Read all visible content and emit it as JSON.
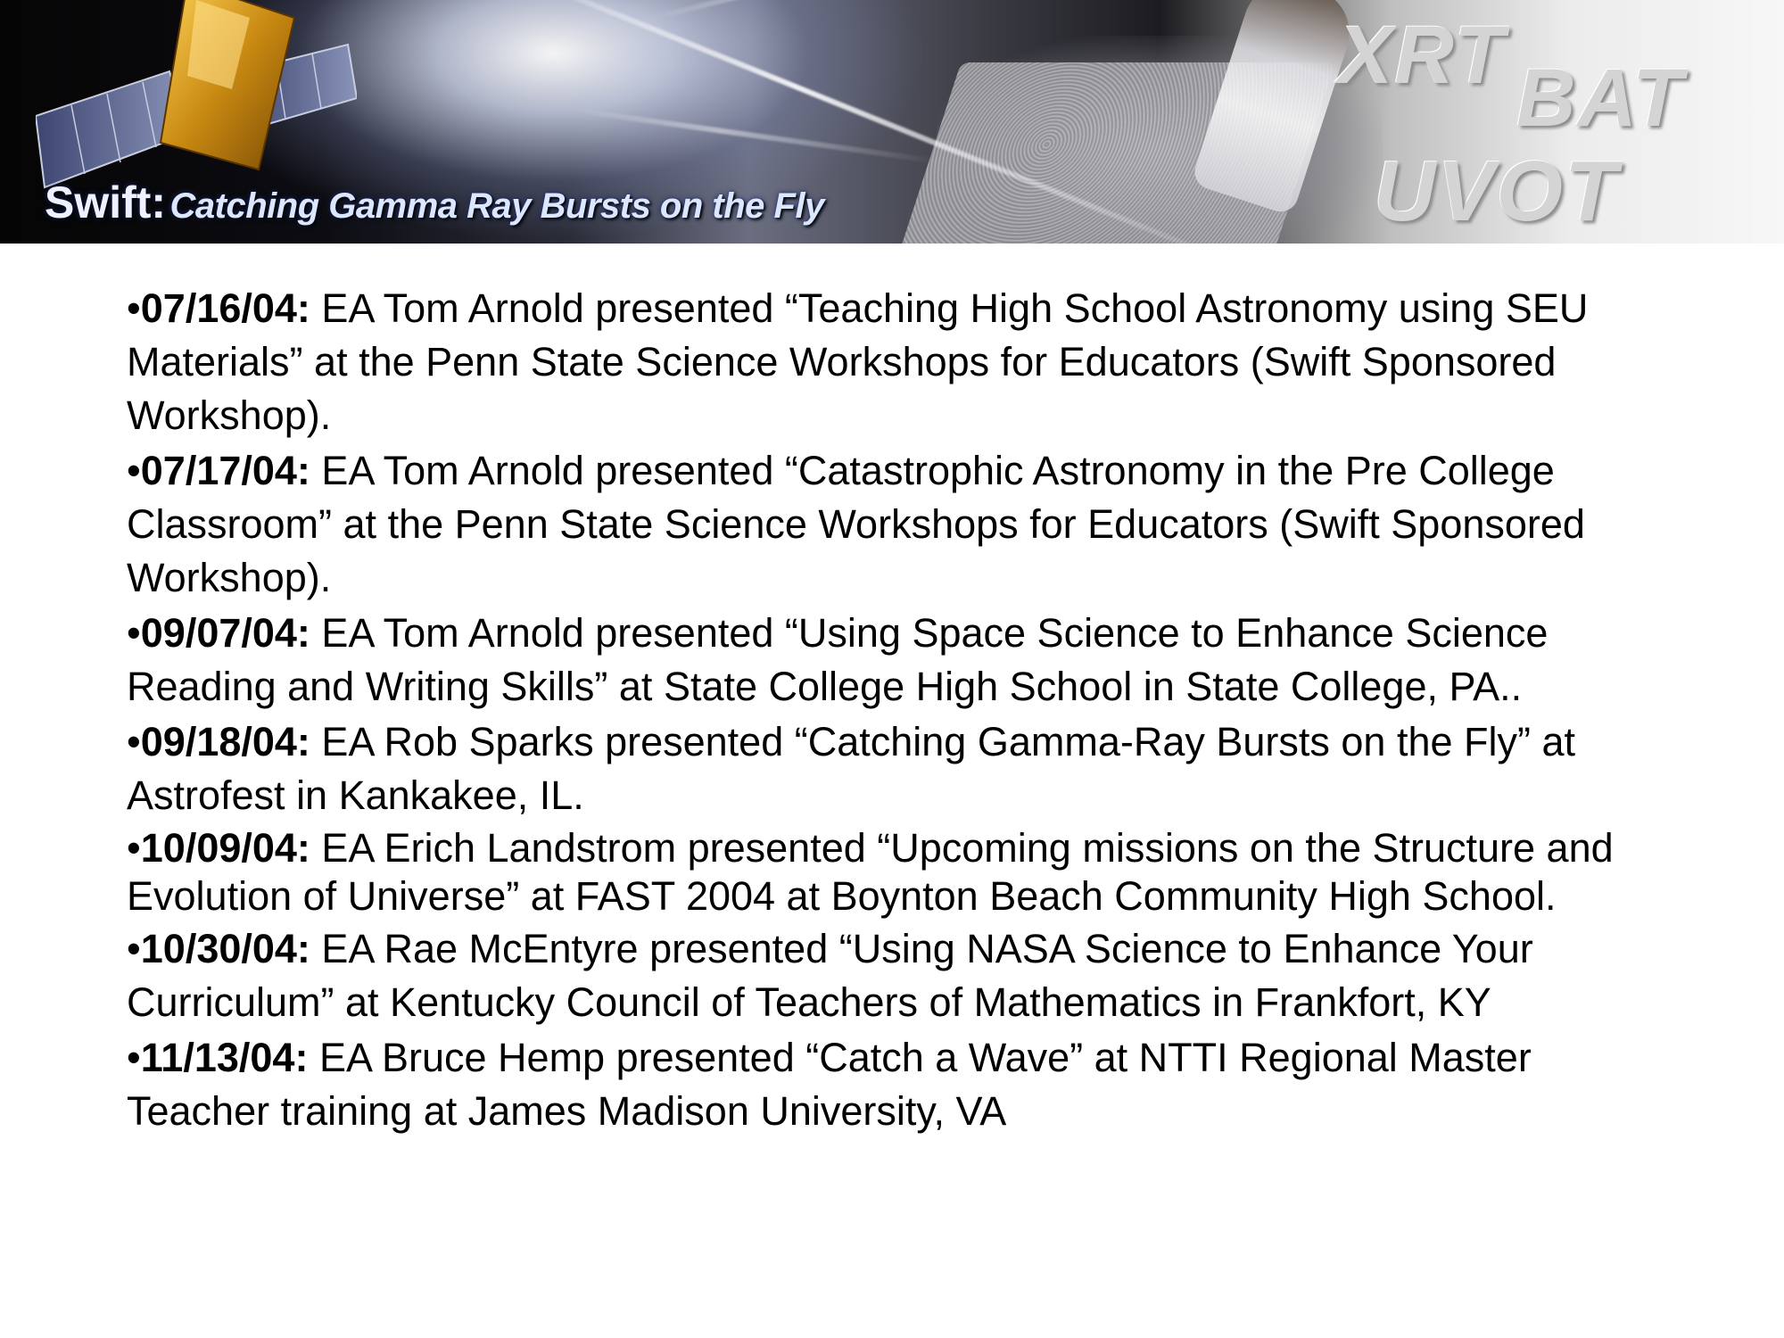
{
  "banner": {
    "title_prefix": "Swift:",
    "title_tagline": "Catching Gamma Ray Bursts on the Fly",
    "instrument_labels": [
      "XRT",
      "BAT",
      "UVOT"
    ]
  },
  "bullet": "•",
  "events": [
    {
      "date": "07/16/04:",
      "text": " EA Tom Arnold presented “Teaching High School Astronomy using SEU Materials” at the Penn State Science Workshops for Educators (Swift Sponsored Workshop)."
    },
    {
      "date": "07/17/04:",
      "text": " EA Tom Arnold presented “Catastrophic Astronomy in the Pre College Classroom” at the Penn State Science Workshops for Educators (Swift Sponsored Workshop)."
    },
    {
      "date": "09/07/04:",
      "text": " EA Tom Arnold presented “Using Space Science to Enhance Science Reading and Writing Skills” at State College High School in State College, PA.."
    },
    {
      "date": "09/18/04:",
      "text": " EA Rob Sparks presented “Catching Gamma-Ray Bursts on the Fly” at Astrofest in Kankakee, IL."
    },
    {
      "date": "10/09/04:",
      "text": " EA Erich Landstrom presented “Upcoming missions on the Structure and Evolution of Universe” at FAST 2004 at Boynton Beach Community High School."
    },
    {
      "date": "10/30/04:",
      "text": " EA Rae McEntyre presented “Using NASA Science to Enhance Your Curriculum” at  Kentucky Council of Teachers of Mathematics in Frankfort, KY"
    },
    {
      "date": "11/13/04:",
      "text": " EA Bruce Hemp presented “Catch a Wave” at NTTI Regional Master Teacher training at James Madison University, VA"
    }
  ]
}
